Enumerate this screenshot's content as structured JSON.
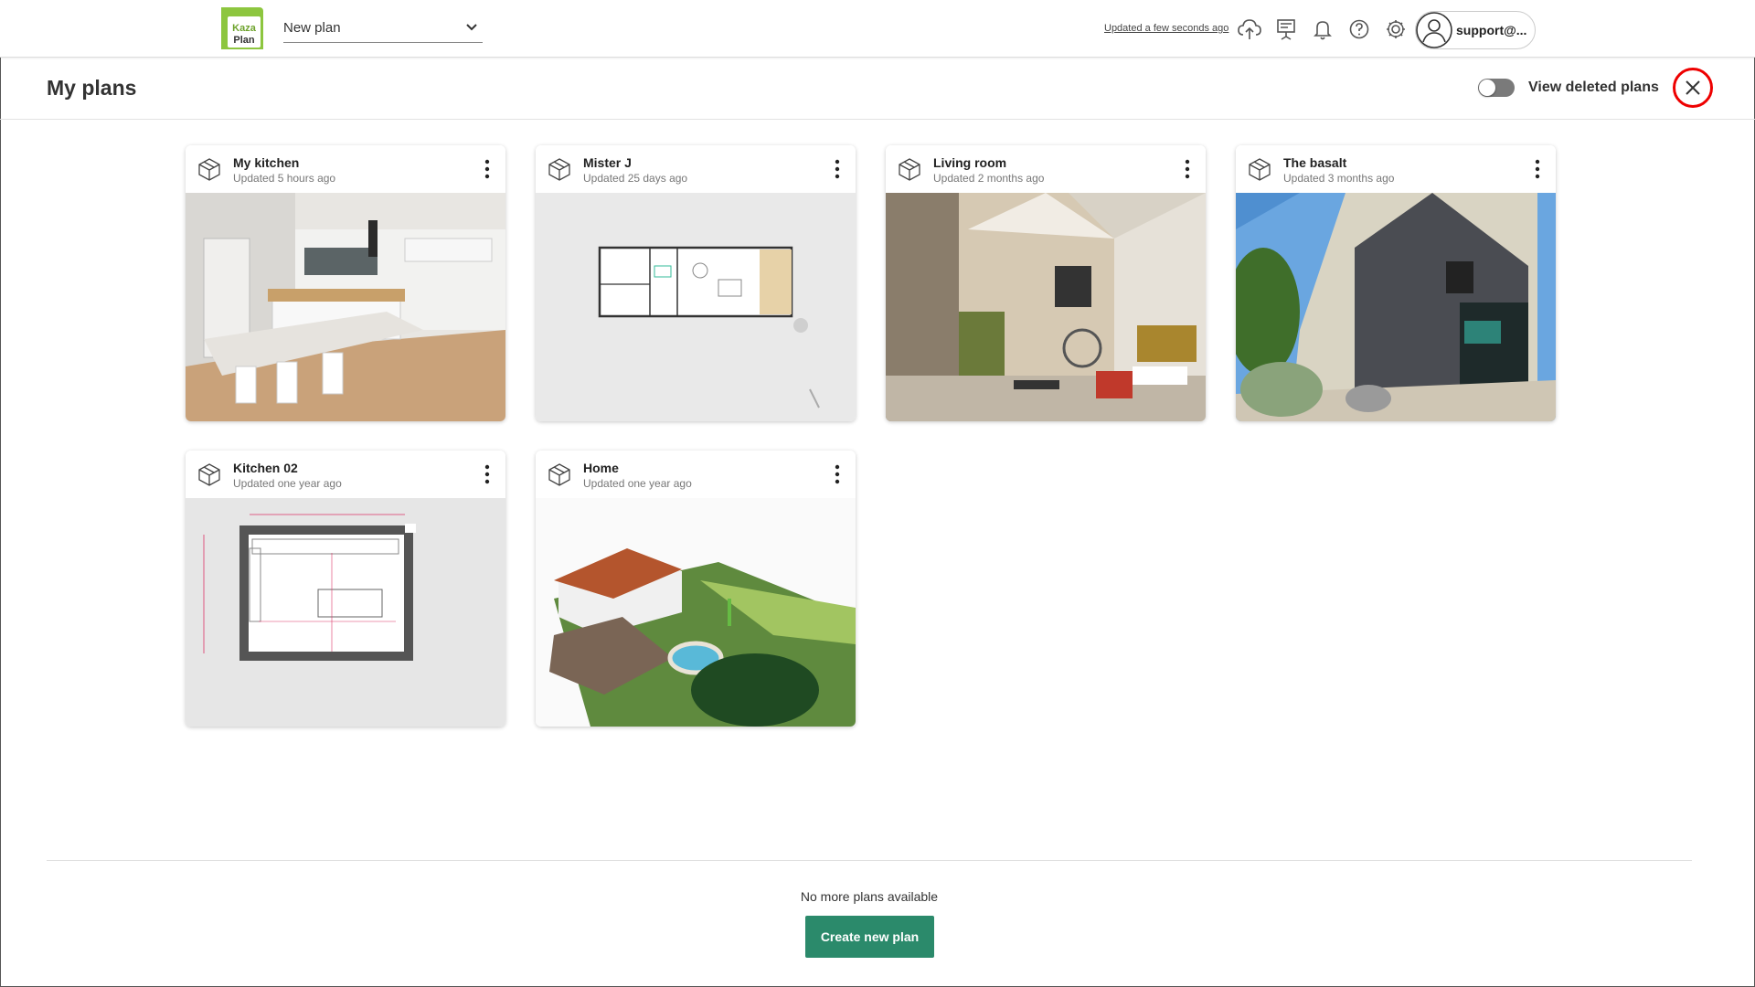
{
  "topbar": {
    "logo_text_top": "Kaza",
    "logo_text_bottom": "Plan",
    "plan_select_value": "New plan",
    "updated_text": "Updated a few seconds ago",
    "icons": [
      "cloud-upload-icon",
      "presentation-icon",
      "bell-icon",
      "help-icon",
      "settings-icon"
    ],
    "user_label": "support@..."
  },
  "header": {
    "title": "My plans",
    "toggle_label": "View deleted plans",
    "toggle_on": false
  },
  "plans": [
    {
      "name": "My kitchen",
      "updated": "Updated 5 hours ago",
      "thumb": "3d-kitchen"
    },
    {
      "name": "Mister J",
      "updated": "Updated 25 days ago",
      "thumb": "2d-floorplan"
    },
    {
      "name": "Living room",
      "updated": "Updated 2 months ago",
      "thumb": "3d-living-room"
    },
    {
      "name": "The basalt",
      "updated": "Updated 3 months ago",
      "thumb": "3d-house-exterior"
    },
    {
      "name": "Kitchen 02",
      "updated": "Updated one year ago",
      "thumb": "2d-kitchen-plan"
    },
    {
      "name": "Home",
      "updated": "Updated one year ago",
      "thumb": "3d-aerial-home"
    }
  ],
  "footer": {
    "no_more_text": "No more plans available",
    "create_label": "Create new plan"
  },
  "colors": {
    "accent": "#2b8a6b",
    "close_ring": "#e00000",
    "logo_green": "#8dc63f"
  }
}
